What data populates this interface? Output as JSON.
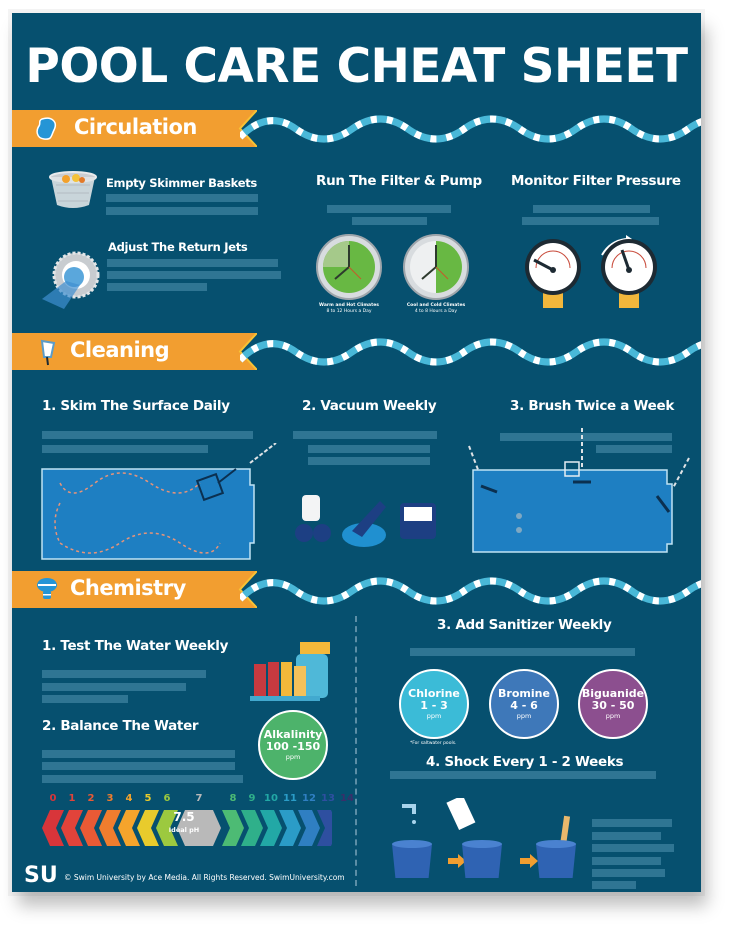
{
  "title": "POOL CARE CHEAT SHEET",
  "sections": {
    "circulation": {
      "label": "Circulation",
      "icon": "pool-icon",
      "items": [
        {
          "title": "Empty Skimmer Baskets",
          "icon": "skimmer-basket-icon"
        },
        {
          "title": "Adjust The Return Jets",
          "icon": "return-jet-icon"
        },
        {
          "title": "Run The Filter & Pump",
          "icon": "clock-icon",
          "clocks": [
            {
              "caption": "Warm and Hot Climates",
              "detail": "8 to 12 Hours a Day"
            },
            {
              "caption": "Cool and Cold Climates",
              "detail": "4 to 8 Hours a Day"
            }
          ]
        },
        {
          "title": "Monitor Filter Pressure",
          "icon": "pressure-gauge-icon"
        }
      ]
    },
    "cleaning": {
      "label": "Cleaning",
      "icon": "skimmer-net-icon",
      "items": [
        {
          "title": "1. Skim The Surface Daily",
          "icon": "pool-skim-diagram"
        },
        {
          "title": "2. Vacuum Weekly",
          "icon": "pool-vacuum-icons"
        },
        {
          "title": "3. Brush Twice a Week",
          "icon": "pool-brush-diagram"
        }
      ]
    },
    "chemistry": {
      "label": "Chemistry",
      "icon": "chemical-floater-icon",
      "items": [
        {
          "title": "1. Test The Water Weekly",
          "icon": "test-strips-icon"
        },
        {
          "title": "2. Balance The Water",
          "alkalinity": {
            "name": "Alkalinity",
            "range": "100 -150",
            "unit": "ppm",
            "color": "#4db36b"
          }
        },
        {
          "title": "3. Add Sanitizer Weekly",
          "sanitizers": [
            {
              "name": "Chlorine",
              "range": "1 - 3",
              "unit": "ppm",
              "color": "#3bbbd7"
            },
            {
              "name": "Bromine",
              "range": "4 - 6",
              "unit": "ppm",
              "color": "#3e78b9"
            },
            {
              "name": "Biguanide",
              "range": "30 - 50",
              "unit": "ppm",
              "color": "#8c4f8f"
            }
          ],
          "note": "*For saltwater pools."
        },
        {
          "title": "4. Shock Every 1 - 2 Weeks",
          "icon": "bucket-steps-icon"
        }
      ]
    }
  },
  "ph_scale": {
    "numbers": [
      "0",
      "1",
      "2",
      "3",
      "4",
      "5",
      "6",
      "7",
      "8",
      "9",
      "10",
      "11",
      "12",
      "13",
      "14"
    ],
    "colors": [
      "#d8353a",
      "#e2433a",
      "#ea5a35",
      "#f07d2e",
      "#f5a42c",
      "#e8cb2c",
      "#9cc93f",
      "#b9b9b9",
      "#4dbb74",
      "#2fb08a",
      "#22a8a6",
      "#2b9cc7",
      "#2f7fc2",
      "#2e4fa0",
      "#3a2f6a"
    ],
    "ideal_value": "7.5",
    "ideal_label": "Ideal pH"
  },
  "footer": {
    "logo": "SU",
    "text": "© Swim University by Ace Media. All Rights Reserved. SwimUniversity.com"
  }
}
